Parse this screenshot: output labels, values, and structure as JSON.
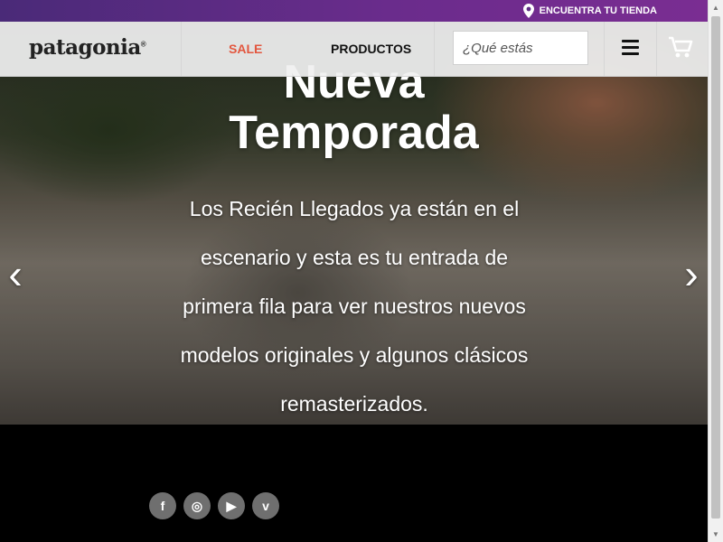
{
  "topbar": {
    "store_link": "ENCUENTRA TU TIENDA",
    "store_icon": "location-pin-icon",
    "color": "#5e2c85"
  },
  "header": {
    "logo": "patagonia",
    "logo_mark": "®",
    "nav": [
      {
        "label": "SALE",
        "color": "#e2573f"
      },
      {
        "label": "PRODUCTOS",
        "color": "#111111"
      }
    ],
    "search_placeholder": "¿Qué estás",
    "menu_icon": "hamburger-menu-icon",
    "cart_icon": "shopping-cart-icon"
  },
  "hero": {
    "title_line1": "Nueva",
    "title_line2": "Temporada",
    "text": "Los Recién Llegados ya están en el escenario y esta es tu entrada de primera fila para ver nuestros nuevos modelos originales y algunos clásicos remasterizados.",
    "prev_icon": "chevron-left-icon",
    "next_icon": "chevron-right-icon"
  },
  "footer": {
    "social": [
      {
        "name": "facebook-icon",
        "glyph": "f"
      },
      {
        "name": "instagram-icon",
        "glyph": "◎"
      },
      {
        "name": "youtube-icon",
        "glyph": "▶"
      },
      {
        "name": "vimeo-icon",
        "glyph": "v"
      }
    ]
  }
}
